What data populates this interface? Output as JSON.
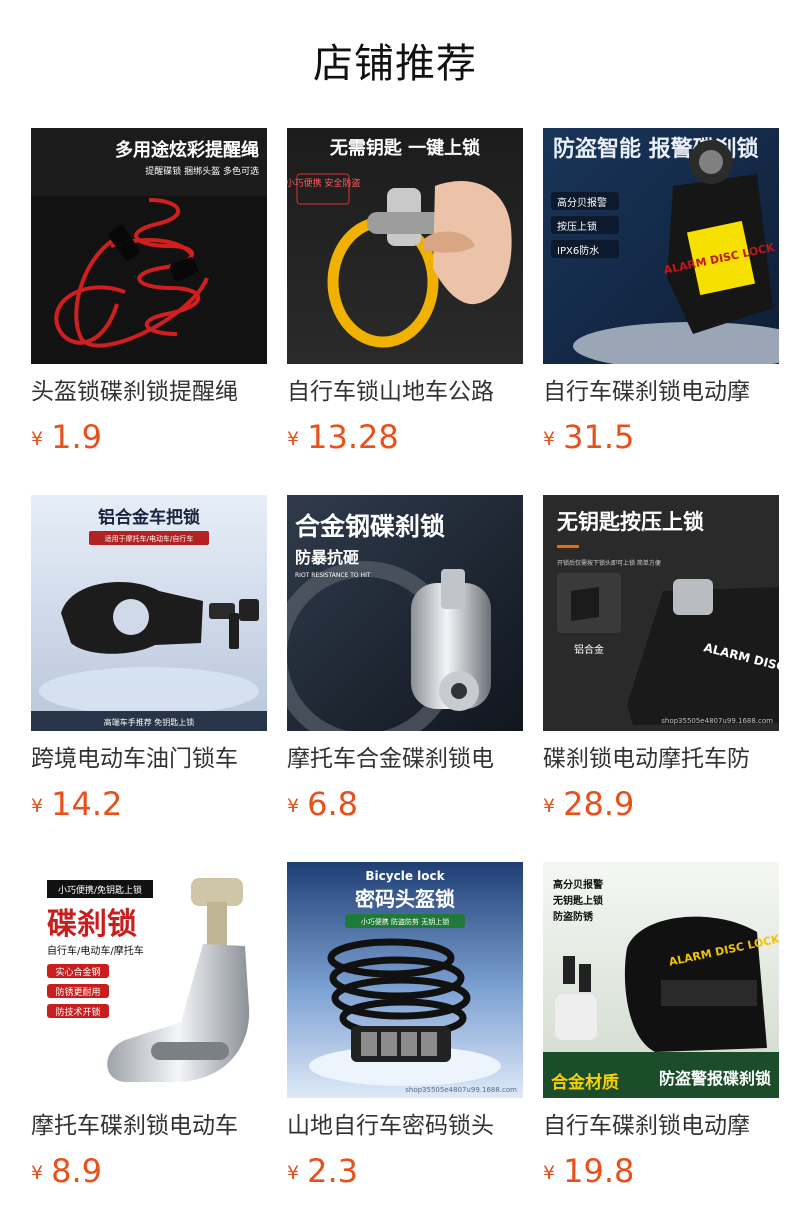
{
  "page": {
    "title": "店铺推荐",
    "currency_symbol": "¥",
    "accent_price_color": "#e8501c"
  },
  "products": [
    {
      "name": "头盔锁碟刹锁提醒绳",
      "price": "1.9",
      "image": {
        "icon": "red-coiled-reminder-cable",
        "headline": "多用途炫彩提醒绳",
        "subline": "提醒碟锁 捆绑头盔 多色可选"
      }
    },
    {
      "name": "自行车锁山地车公路",
      "price": "13.28",
      "image": {
        "icon": "yellow-ring-lock-in-hand",
        "headline": "无需钥匙 一键上锁",
        "badge": "小巧便携 安全防盗"
      }
    },
    {
      "name": "自行车碟刹锁电动摩",
      "price": "31.5",
      "image": {
        "icon": "black-alarm-disc-lock",
        "headline": "防盗智能 报警碟刹锁",
        "features": [
          "高分贝报警",
          "按压上锁",
          "IPX6防水"
        ],
        "lock_text": "ALARM DISC LOCK"
      }
    },
    {
      "name": "跨境电动车油门锁车",
      "price": "14.2",
      "image": {
        "icon": "black-handlebar-lock-with-keys",
        "headline": "铝合金车把锁",
        "subline": "适用于摩托车/电动车/自行车",
        "footer": "高端车手推荐 免钥匙上锁"
      }
    },
    {
      "name": "摩托车合金碟刹锁电",
      "price": "6.8",
      "image": {
        "icon": "chrome-alloy-disc-lock",
        "headline": "合金钢碟刹锁",
        "subline": "防暴抗砸",
        "caption": "RIOT RESISTANCE TO HIT"
      }
    },
    {
      "name": "碟刹锁电动摩托车防",
      "price": "28.9",
      "image": {
        "icon": "black-disc-lock-press-to-lock",
        "headline": "无钥匙按压上锁",
        "subline": "开锁后仅需按下锁头即可上锁 简单方便",
        "label": "铝合金",
        "lock_text": "ALARM DISC LOCK",
        "watermark": "shop35505e4807u99.1688.com"
      }
    },
    {
      "name": "摩托车碟刹锁电动车",
      "price": "8.9",
      "image": {
        "icon": "silver-disc-lock-with-key",
        "tag": "小巧便携/免钥匙上锁",
        "headline": "碟刹锁",
        "subline": "自行车/电动车/摩托车",
        "features": [
          "实心合金钢",
          "防锈更耐用",
          "防技术开锁"
        ]
      }
    },
    {
      "name": "山地自行车密码锁头",
      "price": "2.3",
      "image": {
        "icon": "black-coil-combination-lock",
        "caption": "Bicycle lock",
        "headline": "密码头盔锁",
        "subline": "小巧便携 防盗防剪 无钥上锁",
        "watermark": "shop35505e4807u99.1688.com"
      }
    },
    {
      "name": "自行车碟刹锁电动摩",
      "price": "19.8",
      "image": {
        "icon": "black-alarm-disc-lock-with-keys",
        "features": [
          "高分贝报警",
          "无钥匙上锁",
          "防盗防锈"
        ],
        "lock_text": "ALARM DISC LOCK",
        "footer_left": "合金材质",
        "footer_right": "防盗警报碟刹锁"
      }
    }
  ]
}
